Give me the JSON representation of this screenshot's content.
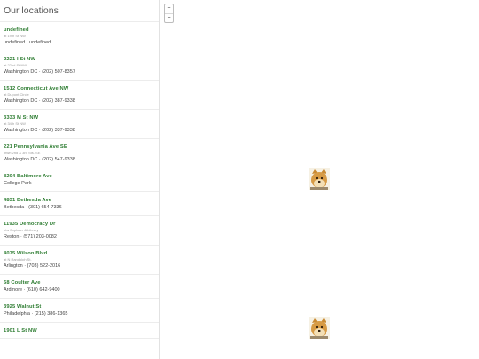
{
  "sidebar": {
    "title": "Our locations",
    "locations": [
      {
        "name": "undefined",
        "sub": "at 19th St NW",
        "info": "undefined · undefined"
      },
      {
        "name": "2221 I St NW",
        "sub": "at 22nd St NW",
        "info": "Washington DC · (202) 507-8357"
      },
      {
        "name": "1512 Connecticut Ave NW",
        "sub": "at Dupont Circle",
        "info": "Washington DC · (202) 387-9338"
      },
      {
        "name": "3333 M St NW",
        "sub": "at 34th St NW",
        "info": "Washington DC · (202) 337-9338"
      },
      {
        "name": "221 Pennsylvania Ave SE",
        "sub": "btwn 2nd & 3rd Sts. SE",
        "info": "Washington DC · (202) 547-9338"
      },
      {
        "name": "8204 Baltimore Ave",
        "sub": "",
        "info": "College Park"
      },
      {
        "name": "4831 Bethesda Ave",
        "sub": "",
        "info": "Bethesda · (301) 654-7336"
      },
      {
        "name": "11935 Democracy Dr",
        "sub": "btw Explorer & Library",
        "info": "Reston · (571) 203-0082"
      },
      {
        "name": "4075 Wilson Blvd",
        "sub": "at N Randolph St.",
        "info": "Arlington · (703) 522-2016"
      },
      {
        "name": "68 Coulter Ave",
        "sub": "",
        "info": "Ardmore · (610) 642-9400"
      },
      {
        "name": "3925 Walnut St",
        "sub": "",
        "info": "Philadelphia · (215) 386-1365"
      },
      {
        "name": "1901 L St NW",
        "sub": "",
        "info": ""
      }
    ]
  },
  "map": {
    "zoom_in_label": "+",
    "zoom_out_label": "−",
    "markers": [
      {
        "icon": "doge-marker-icon"
      },
      {
        "icon": "doge-marker-icon"
      }
    ]
  }
}
